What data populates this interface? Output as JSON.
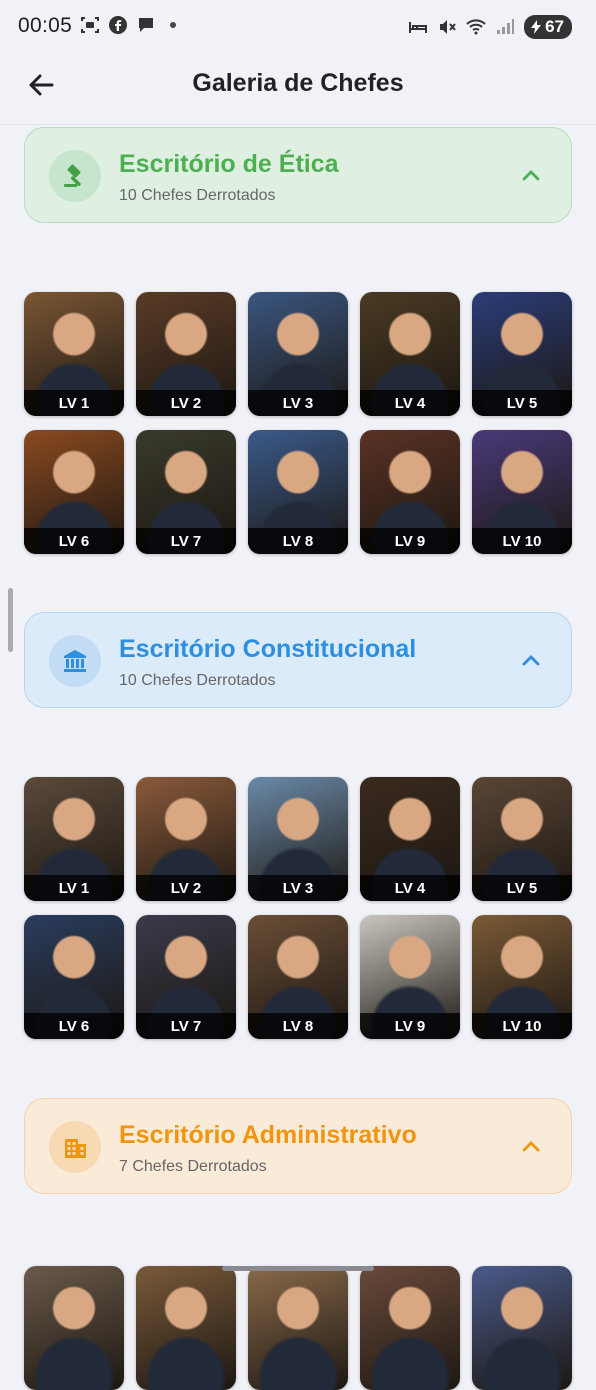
{
  "status_bar": {
    "time": "00:05",
    "battery": "67",
    "icons_left": [
      "screenshot-icon",
      "facebook-icon",
      "chat-icon"
    ],
    "icons_right": [
      "bed-icon",
      "mute-icon",
      "wifi-icon",
      "signal-icon",
      "battery-icon"
    ]
  },
  "app_bar": {
    "title": "Galeria de Chefes"
  },
  "sections": [
    {
      "title": "Escritório de Ética",
      "subtitle": "10 Chefes Derrotados",
      "icon": "gavel-icon",
      "accent": "#4caf50",
      "bg": "#dff0e3",
      "border": "#b7dcc0",
      "icon_bg": "#c6e5cd",
      "tiles": [
        "LV 1",
        "LV 2",
        "LV 3",
        "LV 4",
        "LV 5",
        "LV 6",
        "LV 7",
        "LV 8",
        "LV 9",
        "LV 10"
      ],
      "tile_colors": [
        "#7a5634",
        "#5a3b26",
        "#3a5680",
        "#4a3a22",
        "#2b3d78",
        "#8a4a20",
        "#3a3a2c",
        "#3a5a8a",
        "#5a3224",
        "#4a3a7a"
      ]
    },
    {
      "title": "Escritório Constitucional",
      "subtitle": "10 Chefes Derrotados",
      "icon": "bank-icon",
      "accent": "#2e8fe0",
      "bg": "#dcebfa",
      "border": "#b5d4f2",
      "icon_bg": "#c2dcf5",
      "tiles": [
        "LV 1",
        "LV 2",
        "LV 3",
        "LV 4",
        "LV 5",
        "LV 6",
        "LV 7",
        "LV 8",
        "LV 9",
        "LV 10"
      ],
      "tile_colors": [
        "#5a4a3a",
        "#8a5a3a",
        "#6a8aa8",
        "#3a2a1e",
        "#5a4636",
        "#2a3c5e",
        "#3a3a4a",
        "#6a4e36",
        "#c9c6c0",
        "#7a5a36"
      ]
    },
    {
      "title": "Escritório Administrativo",
      "subtitle": "7 Chefes Derrotados",
      "icon": "building-icon",
      "accent": "#f0950e",
      "bg": "#faebd9",
      "border": "#f3d2aa",
      "icon_bg": "#f7d9b4",
      "tiles": [
        "",
        "",
        "",
        "",
        ""
      ],
      "tile_colors": [
        "#6a5a4a",
        "#7a5a3a",
        "#8a6a4a",
        "#6a4a3a",
        "#4a5a8a"
      ]
    }
  ]
}
